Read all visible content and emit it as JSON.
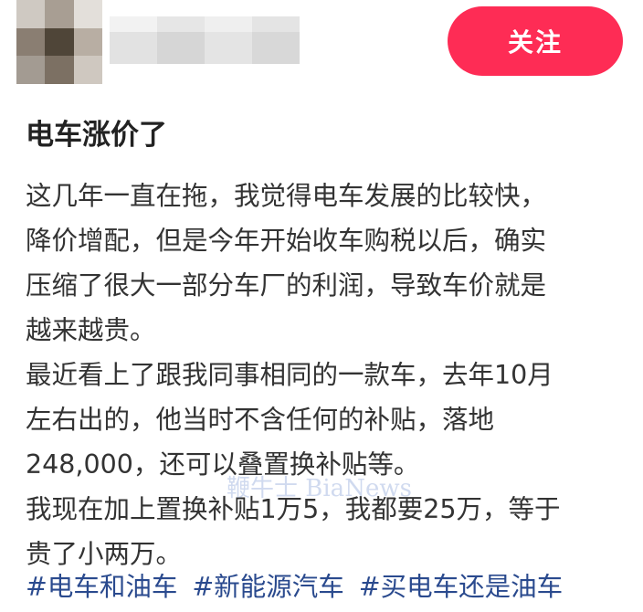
{
  "header": {
    "follow_label": "关注"
  },
  "post": {
    "title": "电车涨价了",
    "lines": [
      "这几年一直在拖，我觉得电车发展的比较快，",
      "降价增配，但是今年开始收车购税以后，确实",
      "压缩了很大一部分车厂的利润，导致车价就是",
      "越来越贵。",
      "最近看上了跟我同事相同的一款车，去年10月",
      "左右出的，他当时不含任何的补贴，落地",
      "248,000，还可以叠置换补贴等。",
      "我现在加上置换补贴1万5，我都要25万，等于",
      "贵了小两万。"
    ],
    "hashtags": [
      "#电车和油车",
      "#新能源汽车",
      "#买电车还是油车"
    ]
  },
  "watermark": {
    "text": "鞭牛士 BiaNews"
  },
  "colors": {
    "follow_bg": "#fe2c55",
    "hashtag": "#2a4a8e",
    "text": "#333333"
  }
}
